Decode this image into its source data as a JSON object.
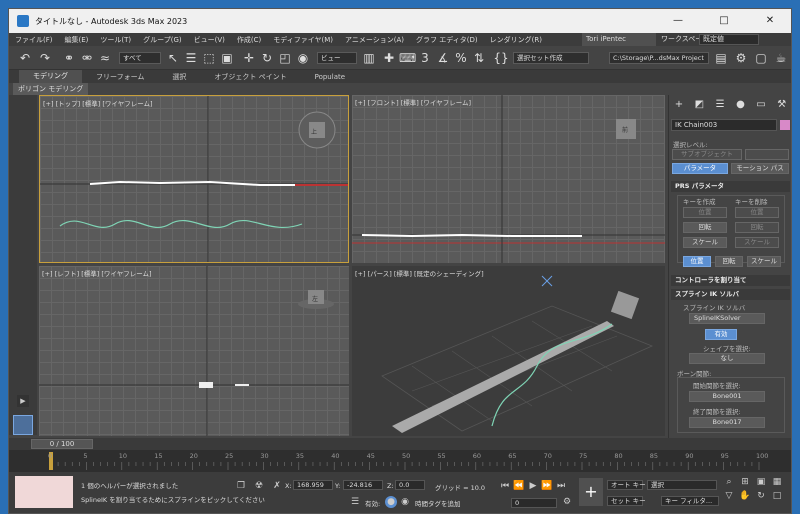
{
  "window": {
    "title": "タイトルなし - Autodesk 3ds Max 2023"
  },
  "menu": {
    "items": [
      "ファイル(F)",
      "編集(E)",
      "ツール(T)",
      "グループ(G)",
      "ビュー(V)",
      "作成(C)",
      "モディファイヤ(M)",
      "アニメーション(A)",
      "グラフ エディタ(D)",
      "レンダリング(R)"
    ],
    "user": "Tori iPentec",
    "workspace_label": "ワークスペース:",
    "workspace_value": "既定値"
  },
  "toolbar": {
    "filter": "すべて",
    "view": "ビュー",
    "selection_set": "選択セット作成",
    "path": "C:\\Storage\\P...dsMax Project"
  },
  "ribbon": {
    "tabs": [
      "モデリング",
      "フリーフォーム",
      "選択",
      "オブジェクト ペイント",
      "Populate"
    ],
    "sub": "ポリゴン モデリング"
  },
  "viewports": {
    "top": "[+] [トップ] [標準] [ワイヤフレーム]",
    "front": "[+] [フロント] [標準] [ワイヤフレーム]",
    "left": "[+] [レフト] [標準] [ワイヤフレーム]",
    "persp": "[+] [パース] [標準] [既定のシェーディング]",
    "cube_top": "上",
    "cube_front": "前",
    "cube_left": "左"
  },
  "panel": {
    "object_name": "IK Chain003",
    "object_color": "#d889c8",
    "selection_level": "選択レベル:",
    "sub_object": "サブオブジェクト",
    "btn_params": "パラメータ",
    "btn_motion_path": "モーション パス",
    "prs_title": "PRS パラメータ",
    "create_key": "キーを作成",
    "delete_key": "キーを削除",
    "position": "位置",
    "rotation": "回転",
    "scale": "スケール",
    "tab_position": "位置",
    "tab_rotation": "回転",
    "tab_scale": "スケール",
    "controller_title": "コントローラを割り当て",
    "spline_ik_title": "スプライン IK ソルバ",
    "spline_ik_solver_label": "スプライン IK ソルバ",
    "solver_value": "SplineIKSolver",
    "enabled": "有効",
    "select_shape": "シェイプを選択:",
    "none": "なし",
    "bone_joint": "ボーン関節:",
    "start_joint": "開始関節を選択:",
    "start_bone": "Bone001",
    "end_joint": "終了関節を選択:",
    "end_bone": "Bone017"
  },
  "timeline": {
    "frame": "0 / 100",
    "ticks": [
      "0",
      "5",
      "10",
      "15",
      "20",
      "25",
      "30",
      "35",
      "40",
      "45",
      "50",
      "55",
      "60",
      "65",
      "70",
      "75",
      "80",
      "85",
      "90",
      "95",
      "100"
    ]
  },
  "status": {
    "line1": "1 個のヘルパーが選択されました",
    "line2": "SplineIK を割り当てるためにスプラインをピックしてください",
    "x_label": "X:",
    "x_value": "168.959",
    "y_label": "Y:",
    "y_value": "-24.816",
    "z_label": "Z:",
    "z_value": "0.0",
    "grid": "グリッド = 10.0",
    "enabled": "有効:",
    "add_time_tag": "時間タグを追加",
    "auto_key": "オート キー",
    "set_key": "セット キー",
    "selected": "選択",
    "key_filter": "キー フィルタ...",
    "frame_value": "0"
  }
}
